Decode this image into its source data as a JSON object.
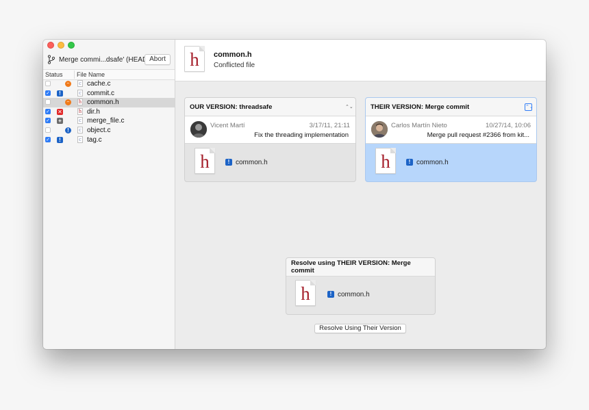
{
  "branch": {
    "label": "Merge commi...dsafe' (HEAD)",
    "abort_label": "Abort"
  },
  "columns": {
    "status": "Status",
    "file_name": "File Name"
  },
  "files": [
    {
      "name": "cache.c",
      "type_letter": "c",
      "checked": false,
      "status": "conflict",
      "status_glyph": "⇔"
    },
    {
      "name": "commit.c",
      "type_letter": "c",
      "checked": true,
      "status": "modified",
      "status_glyph": "!"
    },
    {
      "name": "common.h",
      "type_letter": "h",
      "checked": false,
      "status": "conflict",
      "status_glyph": "⇔",
      "selected": true
    },
    {
      "name": "dir.h",
      "type_letter": "h",
      "checked": true,
      "status": "deleted",
      "status_glyph": "✕"
    },
    {
      "name": "merge_file.c",
      "type_letter": "c",
      "checked": true,
      "status": "added",
      "status_glyph": "+"
    },
    {
      "name": "object.c",
      "type_letter": "c",
      "checked": false,
      "status": "warning",
      "status_glyph": "!"
    },
    {
      "name": "tag.c",
      "type_letter": "c",
      "checked": true,
      "status": "modified",
      "status_glyph": "!"
    }
  ],
  "header": {
    "file_letter": "h",
    "title": "common.h",
    "subtitle": "Conflicted file"
  },
  "ours": {
    "title": "OUR VERSION: threadsafe",
    "author": "Vicent Martí",
    "date": "3/17/11, 21:11",
    "message": "Fix the threading implementation",
    "file_letter": "h",
    "file_name": "common.h"
  },
  "theirs": {
    "title": "THEIR VERSION: Merge commit",
    "author": "Carlos Martín Nieto",
    "date": "10/27/14, 10:06",
    "message": "Merge pull request #2366 from kit...",
    "file_letter": "h",
    "file_name": "common.h"
  },
  "resolve": {
    "title": "Resolve using THEIR VERSION: Merge commit",
    "file_letter": "h",
    "file_name": "common.h",
    "button_label": "Resolve Using Their Version"
  },
  "colors": {
    "accent": "#2f7cf6",
    "selected_panel": "#b7d6fb",
    "conflict": "#f07a1a",
    "modified": "#1c63c6",
    "deleted": "#e22828",
    "header_letter": "#a51f2b"
  }
}
